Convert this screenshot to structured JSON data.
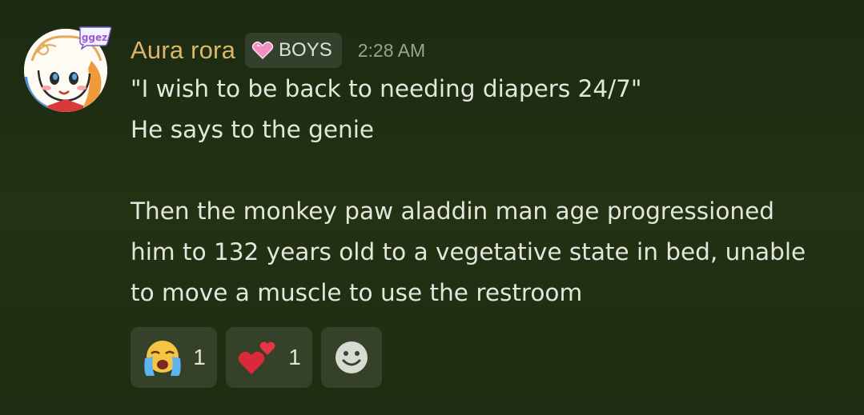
{
  "message": {
    "author": "Aura rora",
    "role_tag": "BOYS",
    "timestamp": "2:28 AM",
    "lines": [
      "\"I wish to be back to needing diapers 24/7\"",
      "He says to the genie",
      "",
      "Then the monkey paw aladdin man age progressioned",
      "him to 132 years old to a vegetative state in bed, unable",
      "to move a muscle to use the restroom"
    ],
    "avatar_badge_text": "ggez"
  },
  "reactions": [
    {
      "emoji": "loudly-crying-face-icon",
      "count": "1"
    },
    {
      "emoji": "heart-exclamation-icon",
      "count": "1"
    }
  ],
  "add_reaction": {
    "icon": "add-reaction-smiley-icon"
  },
  "colors": {
    "background": "#1f2c11",
    "username": "#d9b86c",
    "role_tag_bg": "#33402b",
    "reaction_bg": "#354229",
    "text": "#e3e6dd",
    "timestamp": "#9aa38f",
    "role_heart": "#f08fc0"
  }
}
